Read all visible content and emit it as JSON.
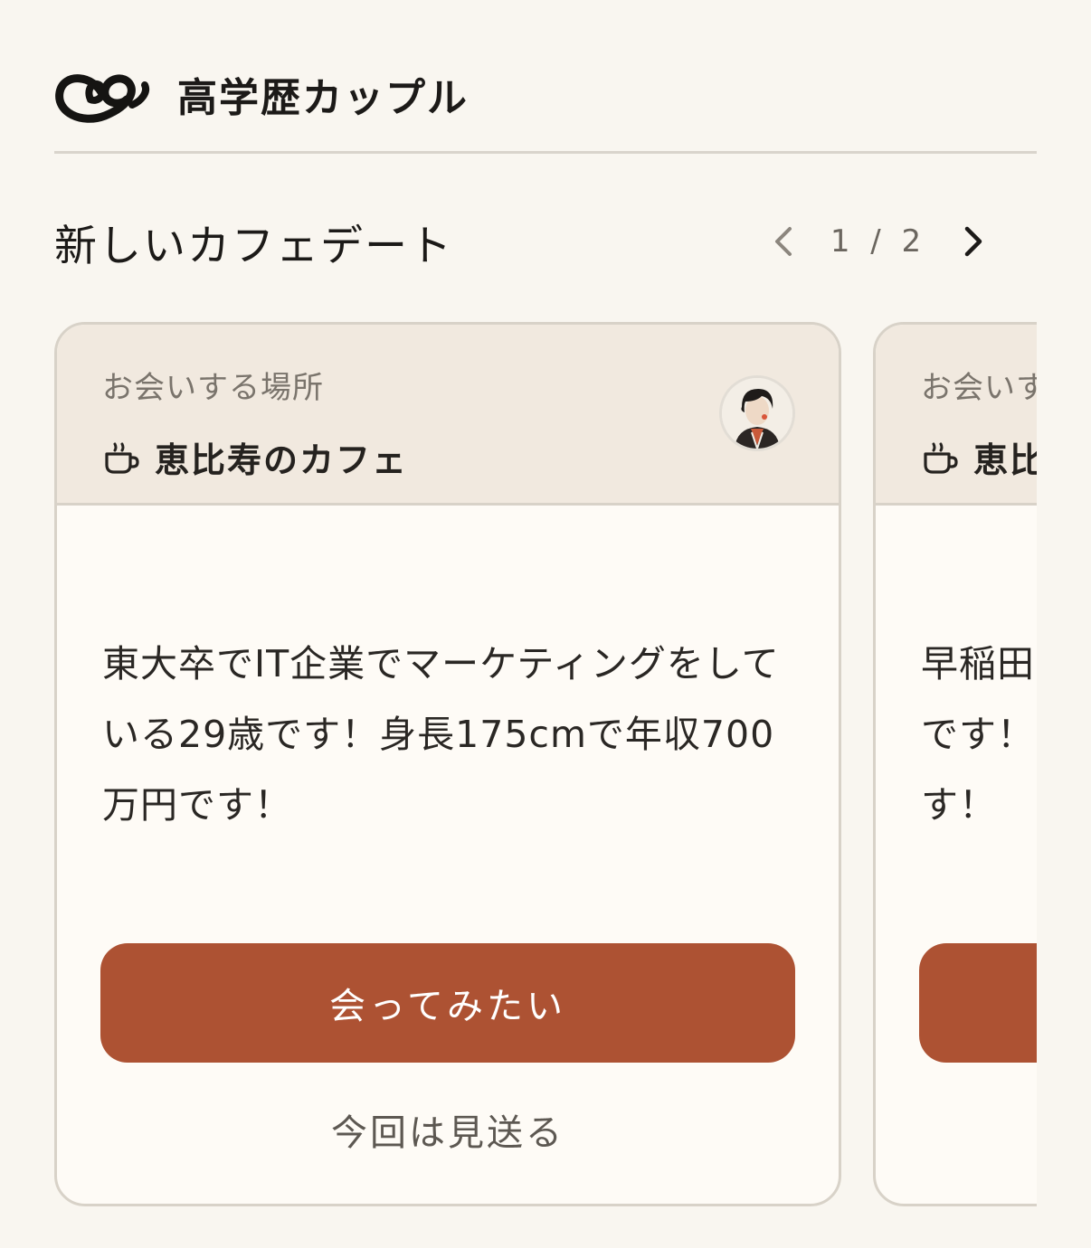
{
  "header": {
    "app_title": "高学歴カップル",
    "logo_icon": "infinity-swirl-logo"
  },
  "section": {
    "title": "新しいカフェデート",
    "pager": {
      "current": 1,
      "total": 2,
      "text": "1 / 2"
    }
  },
  "cards": [
    {
      "place_label": "お会いする場所",
      "place_icon": "coffee-cup-icon",
      "place_name": "恵比寿のカフェ",
      "description": "東大卒でIT企業でマーケティングをしている29歳です！身長175cmで年収700万円です！",
      "meet_button": "会ってみたい",
      "skip_button": "今回は見送る"
    },
    {
      "place_label": "お会いす",
      "place_icon": "coffee-cup-icon",
      "place_name": "恵比",
      "description": "早稲田\nです！\nす！"
    }
  ],
  "colors": {
    "background": "#f9f6f0",
    "card_header": "#f1e9df",
    "accent_button": "#ad5233",
    "border": "#d8d2c8"
  }
}
